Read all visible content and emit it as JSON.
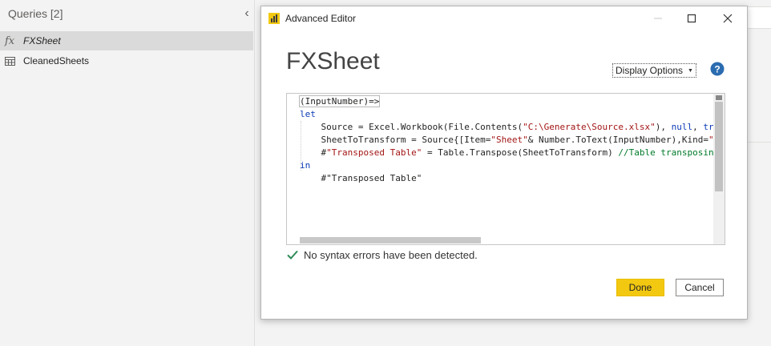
{
  "queries_pane": {
    "header": "Queries [2]",
    "collapse_icon": "chevron-left-icon",
    "items": [
      {
        "label": "FXSheet",
        "icon": "fx",
        "selected": true
      },
      {
        "label": "CleanedSheets",
        "icon": "table-icon",
        "selected": false
      }
    ]
  },
  "dialog": {
    "title": "Advanced Editor",
    "query_name": "FXSheet",
    "display_options": "Display Options",
    "code_lines": [
      "(InputNumber)=>",
      "let",
      "    Source = Excel.Workbook(File.Contents(\"C:\\Generate\\Source.xlsx\"), null, true",
      "    SheetToTransform = Source{[Item=\"Sheet\"& Number.ToText(InputNumber),Kind=\"She",
      "    #\"Transposed Table\" = Table.Transpose(SheetToTransform) //Table transposing",
      "in",
      "    #\"Transposed Table\""
    ],
    "status": "No syntax errors have been detected.",
    "done_label": "Done",
    "cancel_label": "Cancel"
  },
  "colors": {
    "accent_yellow": "#f2c811",
    "keyword_blue": "#0a3bb5",
    "string_red": "#a31515",
    "comment_green": "#007a2a",
    "success_green": "#2e8b57"
  }
}
